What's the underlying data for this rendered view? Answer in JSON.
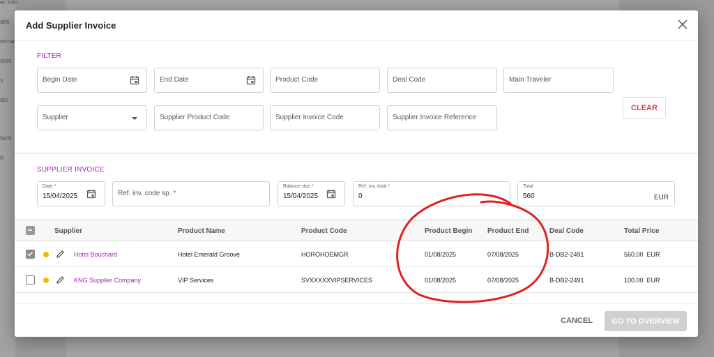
{
  "background": {
    "sidebar_items": [
      "er Info",
      "ails",
      "orma",
      "olds",
      "s",
      "als",
      "tock",
      "n"
    ]
  },
  "modal": {
    "title": "Add Supplier Invoice"
  },
  "filter": {
    "section_title": "FILTER",
    "begin_date": "Begin Date",
    "end_date": "End Date",
    "product_code": "Product Code",
    "deal_code": "Deal Code",
    "main_traveler": "Main Traveler",
    "supplier": "Supplier",
    "supplier_product_code": "Supplier Product Code",
    "supplier_invoice_code": "Supplier Invoice Code",
    "supplier_invoice_reference": "Supplier Invoice Reference",
    "clear_label": "CLEAR"
  },
  "supplier_invoice": {
    "section_title": "SUPPLIER INVOICE",
    "date_label": "Date",
    "date_value": "15/04/2025",
    "ref_code_placeholder": "Ref. inv. code sp.",
    "balance_due_label": "Balance due",
    "balance_due_value": "15/04/2025",
    "ref_total_label": "Ref. inv. total",
    "ref_total_value": "0",
    "total_label": "Total",
    "total_value": "560",
    "total_unit": "EUR",
    "required_mark": "*"
  },
  "table": {
    "headers": {
      "supplier": "Supplier",
      "product_name": "Product Name",
      "product_code": "Product Code",
      "product_begin": "Product Begin",
      "product_end": "Product End",
      "deal_code": "Deal Code",
      "total_price": "Total Price"
    },
    "rows": [
      {
        "checked": true,
        "supplier": "Hotel Bouchard",
        "product_name": "Hotel Emerald Groove",
        "product_code": "HOROHOEMGR",
        "product_begin": "01/08/2025",
        "product_end": "07/08/2025",
        "deal_code": "B-DB2-2491",
        "total_price": "560.00  EUR"
      },
      {
        "checked": false,
        "supplier": "KNG Supplier Company",
        "product_name": "VIP Services",
        "product_code": "SVXXXXXVIPSERVICES",
        "product_begin": "01/08/2025",
        "product_end": "07/08/2025",
        "deal_code": "B-DB2-2491",
        "total_price": "100.00  EUR"
      }
    ]
  },
  "footer": {
    "cancel_label": "CANCEL",
    "overview_label": "GO TO OVERVIEW"
  },
  "colors": {
    "accent": "#9c27b0",
    "danger": "#e53950",
    "status_dot": "#f5b800",
    "annotation": "#e02020"
  }
}
